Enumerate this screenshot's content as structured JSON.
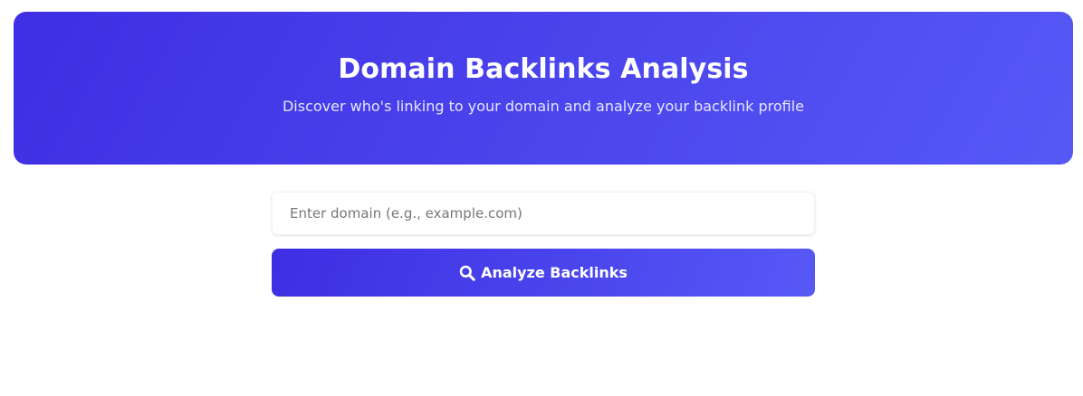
{
  "hero": {
    "title": "Domain Backlinks Analysis",
    "subtitle": "Discover who's linking to your domain and analyze your backlink profile"
  },
  "form": {
    "domain_input": {
      "value": "",
      "placeholder": "Enter domain (e.g., example.com)"
    },
    "analyze_button": {
      "label": "Analyze Backlinks",
      "icon": "search-icon"
    }
  },
  "colors": {
    "accent_start": "#3f2ee3",
    "accent_end": "#5659f6",
    "text_on_accent": "#ffffff"
  }
}
